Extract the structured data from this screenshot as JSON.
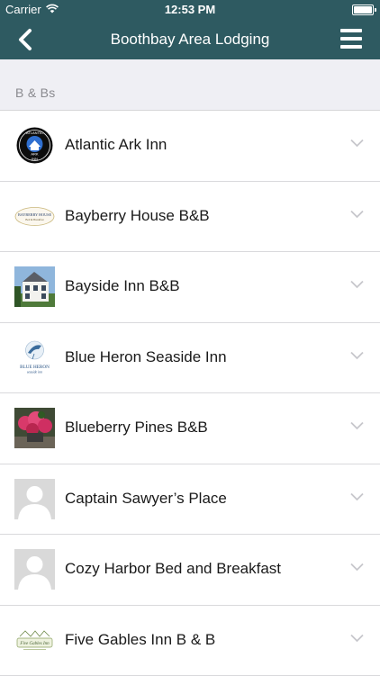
{
  "status_bar": {
    "carrier": "Carrier",
    "time": "12:53 PM",
    "icons": [
      "wifi-icon",
      "battery-icon"
    ]
  },
  "nav": {
    "title": "Boothbay Area Lodging",
    "back_icon": "chevron-left-icon",
    "menu_icon": "hamburger-menu-icon"
  },
  "section": {
    "title": "B & Bs"
  },
  "listings": [
    {
      "name": "Atlantic Ark Inn",
      "thumb": "atlantic-ark-logo"
    },
    {
      "name": "Bayberry House B&B",
      "thumb": "bayberry-house-logo"
    },
    {
      "name": "Bayside Inn B&B",
      "thumb": "bayside-inn-photo"
    },
    {
      "name": "Blue Heron Seaside Inn",
      "thumb": "blue-heron-logo"
    },
    {
      "name": "Blueberry Pines B&B",
      "thumb": "blueberry-pines-photo"
    },
    {
      "name": "Captain Sawyer’s Place",
      "thumb": "placeholder-avatar"
    },
    {
      "name": "Cozy Harbor Bed and Breakfast",
      "thumb": "placeholder-avatar"
    },
    {
      "name": "Five Gables Inn B & B",
      "thumb": "five-gables-logo"
    }
  ],
  "logo_text": {
    "atlantic_ark": [
      "ATLANTIC",
      "ARK",
      "INN"
    ],
    "bayberry": [
      "BAYBERRY HOUSE",
      "Bed & Breakfast"
    ],
    "blue_heron": [
      "BLUE HERON",
      "seaside inn"
    ],
    "five_gables": [
      "Five Gables Inn"
    ]
  },
  "colors": {
    "nav_bg": "#2e5a61",
    "section_bg": "#efeff4",
    "chevron": "#c7c7cc"
  }
}
